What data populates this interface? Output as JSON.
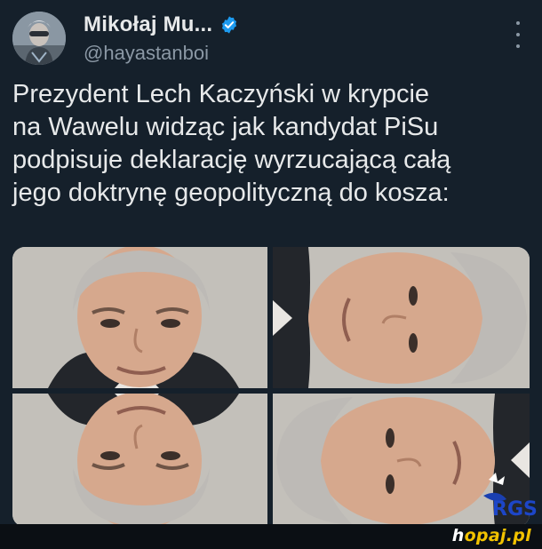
{
  "tweet": {
    "display_name": "Mikołaj Mu...",
    "handle": "@hayastanboi",
    "text": "Prezydent Lech Kaczyński w krypcie\nna Wawelu widząc jak kandydat PiSu\npodpisuje deklarację wyrzucającą całą\njego doktrynę geopolityczną do kosza:"
  },
  "icons": {
    "verified": "verified-badge-icon",
    "more": "more-options-icon"
  },
  "watermark": {
    "prefix": "h",
    "site": "opaj.pl",
    "logo_text": "RGS"
  },
  "colors": {
    "background": "#15202b",
    "text": "#e7e9ea",
    "secondary": "#8b98a5",
    "verified": "#1d9bf0"
  }
}
